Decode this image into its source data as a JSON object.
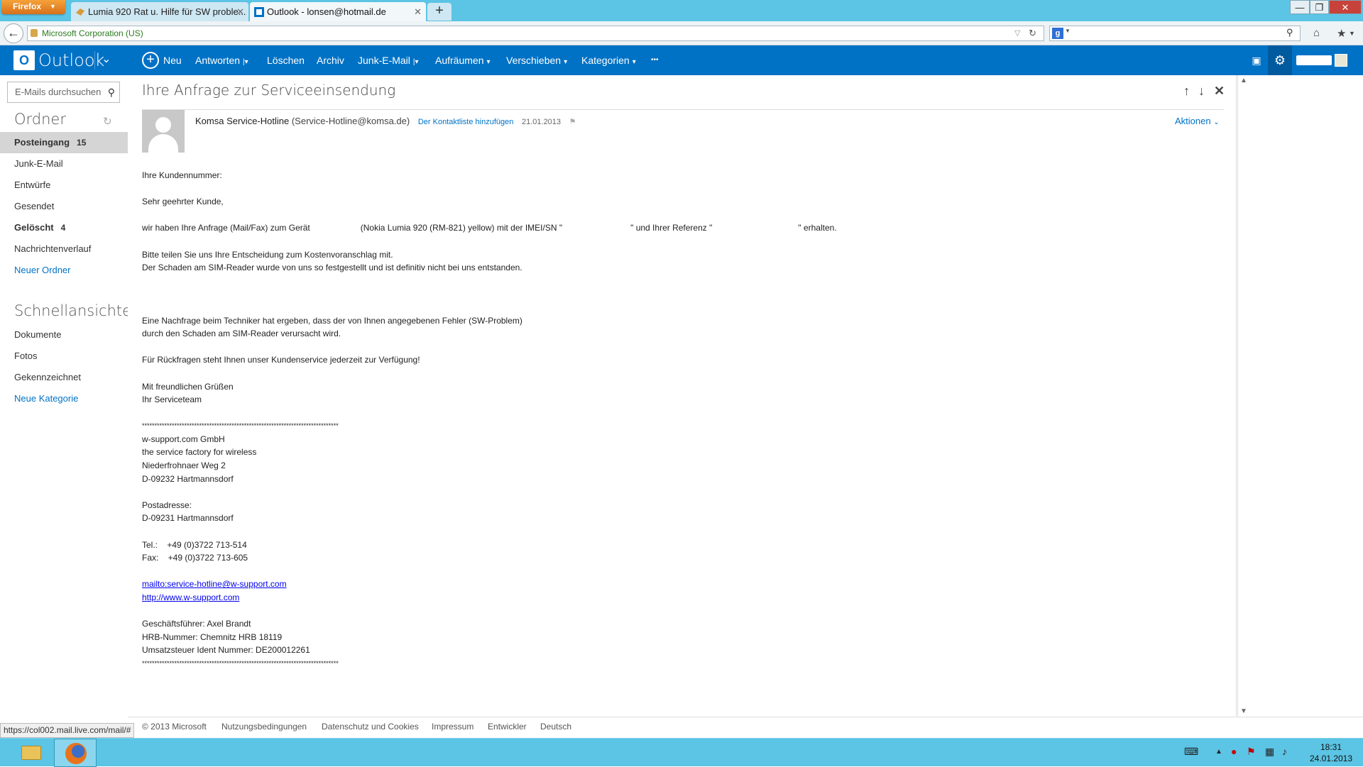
{
  "browser": {
    "menu_button": "Firefox",
    "tabs": [
      {
        "title": "Lumia 920 Rat u. Hilfe für SW proble...",
        "active": false
      },
      {
        "title": "Outlook - lonsen@hotmail.de",
        "active": true
      }
    ],
    "new_tab": "+",
    "identity": "Microsoft Corporation (US)",
    "status_url": "https://col002.mail.live.com/mail/#"
  },
  "outlook": {
    "app_name": "Outlook",
    "commands": {
      "new": "Neu",
      "reply": "Antworten",
      "delete": "Löschen",
      "archive": "Archiv",
      "junk": "Junk-E-Mail",
      "sweep": "Aufräumen",
      "move": "Verschieben",
      "categories": "Kategorien",
      "more": "•••"
    },
    "accent": "#0072c6"
  },
  "sidebar": {
    "search_placeholder": "E-Mails durchsuchen",
    "folders_title": "Ordner",
    "folders": [
      {
        "label": "Posteingang",
        "count": "15",
        "active": true,
        "bold": true
      },
      {
        "label": "Junk-E-Mail",
        "count": "",
        "active": false,
        "bold": false
      },
      {
        "label": "Entwürfe",
        "count": "",
        "active": false,
        "bold": false
      },
      {
        "label": "Gesendet",
        "count": "",
        "active": false,
        "bold": false
      },
      {
        "label": "Gelöscht",
        "count": "4",
        "active": false,
        "bold": true
      },
      {
        "label": "Nachrichtenverlauf",
        "count": "",
        "active": false,
        "bold": false
      }
    ],
    "new_folder": "Neuer Ordner",
    "quick_views_title": "Schnellansichten",
    "quick_views": [
      "Dokumente",
      "Fotos",
      "Gekennzeichnet"
    ],
    "new_category": "Neue Kategorie"
  },
  "message": {
    "subject": "Ihre Anfrage zur Serviceeinsendung",
    "sender_name": "Komsa Service-Hotline",
    "sender_address": "(Service-Hotline@komsa.de)",
    "add_contact": "Der Kontaktliste hinzufügen",
    "date": "21.01.2013",
    "actions": "Aktionen",
    "body": {
      "l1": "Ihre Kundennummer:",
      "l2": "Sehr geehrter Kunde,",
      "l3a": "wir haben Ihre Anfrage (Mail/Fax) zum Gerät",
      "l3b": "(Nokia Lumia 920 (RM-821) yellow) mit der IMEI/SN \"",
      "l3c": "\" und Ihrer Referenz \"",
      "l3d": "\" erhalten.",
      "l4": "Bitte teilen Sie uns Ihre Entscheidung zum Kostenvoranschlag mit.",
      "l5": "Der Schaden am SIM-Reader wurde von uns so festgestellt und ist definitiv nicht bei uns entstanden.",
      "l6": "Eine Nachfrage beim Techniker hat ergeben, dass der von Ihnen angegebenen Fehler (SW-Problem)",
      "l7": "durch den Schaden am SIM-Reader verursacht wird.",
      "l8": "Für Rückfragen steht Ihnen unser Kundenservice jederzeit zur Verfügung!",
      "l9": "Mit freundlichen Grüßen",
      "l10": "Ihr Serviceteam",
      "stars": "*******************************************************************************",
      "c1": "w-support.com GmbH",
      "c2": "the service factory for wireless",
      "c3": "Niederfrohnaer Weg 2",
      "c4": "D-09232 Hartmannsdorf",
      "c5": "Postadresse:",
      "c6": "D-09231 Hartmannsdorf",
      "tel": "Tel.:    +49 (0)3722 713-514",
      "fax": "Fax:    +49 (0)3722 713-605",
      "mail": "mailto:service-hotline@w-support.com",
      "web": "http://www.w-support.com",
      "g1": "Geschäftsführer: Axel Brandt",
      "g2": "HRB-Nummer: Chemnitz HRB 18119",
      "g3": "Umsatzsteuer Ident Nummer: DE200012261"
    }
  },
  "footer": {
    "copyright": "© 2013 Microsoft",
    "links": [
      "Nutzungsbedingungen",
      "Datenschutz und Cookies",
      "Impressum",
      "Entwickler",
      "Deutsch"
    ]
  },
  "taskbar": {
    "time": "18:31",
    "date": "24.01.2013"
  }
}
